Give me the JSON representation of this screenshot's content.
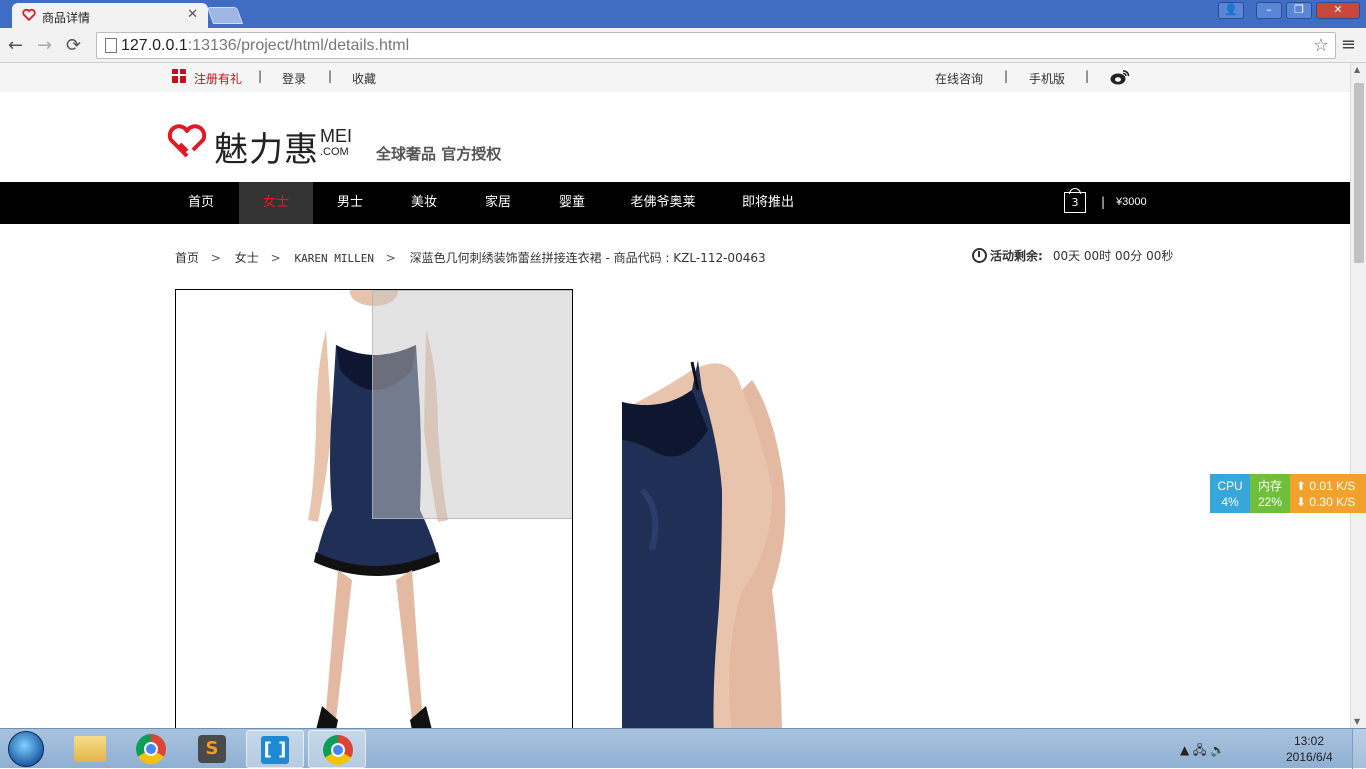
{
  "browser": {
    "tab_title": "商品详情",
    "tab_close": "✕",
    "url_host": "127.0.0.1",
    "url_rest": ":13136/project/html/details.html",
    "controls": {
      "user": "👤",
      "minimize": "–",
      "restore": "❐",
      "close": "✕"
    }
  },
  "topbar": {
    "register": "注册有礼",
    "login": "登录",
    "favorite": "收藏",
    "consult": "在线咨询",
    "mobile": "手机版",
    "sep": "|"
  },
  "header": {
    "logo_cn": "魅力惠",
    "logo_mei": "MEI",
    "logo_com": ".COM",
    "slogan": "全球奢品 官方授权"
  },
  "nav": {
    "items": [
      "首页",
      "女士",
      "男士",
      "美妆",
      "家居",
      "婴童",
      "老佛爷奥莱",
      "即将推出"
    ],
    "active_index": 1,
    "cart_count": "3",
    "cart_sep": "|",
    "cart_amount": "¥3000"
  },
  "breadcrumb": {
    "home": "首页",
    "category": "女士",
    "brand": "KAREN MILLEN",
    "product": "深蓝色几何刺绣装饰蕾丝拼接连衣裙 - 商品代码 : KZL-112-00463",
    "arrow": ">"
  },
  "countdown": {
    "label": "活动剩余:",
    "value": "00天 00时 00分 00秒"
  },
  "sysmon": {
    "cpu_label": "CPU",
    "cpu_value": "4%",
    "mem_label": "内存",
    "mem_value": "22%",
    "up": "0.01 K/S",
    "down": "0.30 K/S",
    "up_arrow": "⬆",
    "down_arrow": "⬇"
  },
  "taskbar": {
    "time": "13:02",
    "date": "2016/6/4",
    "sublime_letter": "S",
    "brackets_glyph": "[ ]",
    "tray_icons": "▲ 🖧 🔊"
  },
  "colors": {
    "accent_red": "#e01b24",
    "nav_bg": "#000000",
    "dress_blue": "#1f2f56"
  }
}
